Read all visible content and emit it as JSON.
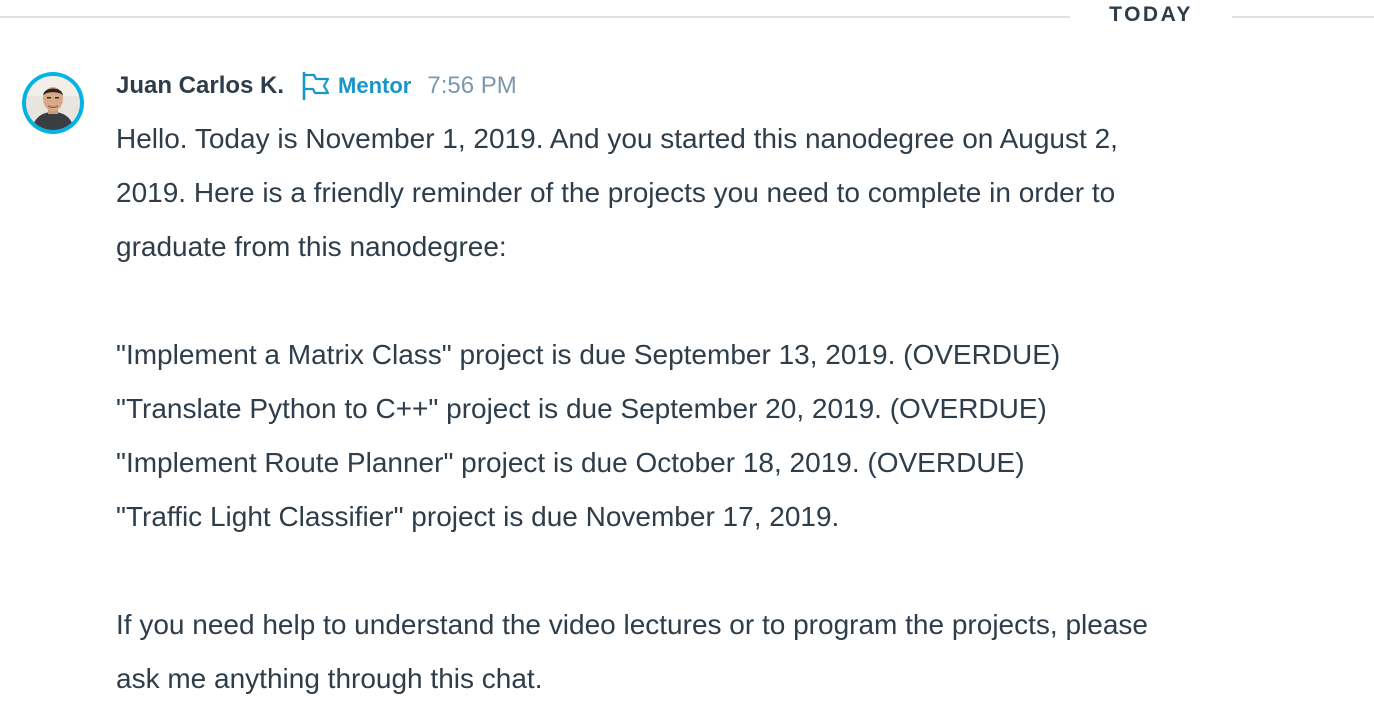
{
  "divider": {
    "label": "TODAY"
  },
  "message": {
    "author": "Juan Carlos K.",
    "role": "Mentor",
    "time": "7:56 PM",
    "avatar_icon": "person-avatar",
    "role_icon": "flag-icon",
    "accent_color": "#02b3e4",
    "role_color": "#1796c9",
    "paragraph1_lines": [
      "Hello. Today is November 1, 2019. And you started this nanodegree on August 2,",
      "2019. Here is a friendly reminder of the projects you need to complete in order to",
      "graduate from this nanodegree:"
    ],
    "projects": [
      "\"Implement a Matrix Class\" project is due September 13, 2019. (OVERDUE)",
      "\"Translate Python to C++\" project is due September 20, 2019. (OVERDUE)",
      "\"Implement Route Planner\" project is due October 18, 2019. (OVERDUE)",
      "\"Traffic Light Classifier\" project is due November 17, 2019."
    ],
    "paragraph3_lines": [
      "If you need help to understand the video lectures or to program the projects, please",
      "ask me anything through this chat."
    ]
  }
}
